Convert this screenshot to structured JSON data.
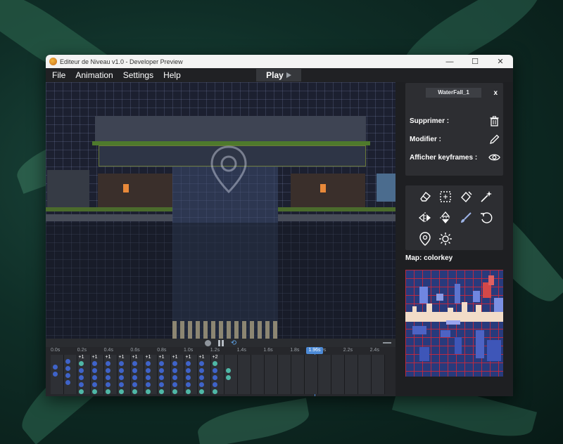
{
  "window": {
    "title": "Editeur de Niveau v1.0 - Developer Preview",
    "controls": {
      "minimize": "—",
      "maximize": "☐",
      "close": "✕"
    }
  },
  "menu": {
    "items": [
      "File",
      "Animation",
      "Settings",
      "Help"
    ],
    "play_label": "Play"
  },
  "inspector": {
    "object_name": "WaterFall_1",
    "close_label": "x",
    "rows": [
      {
        "label": "Supprimer :",
        "icon": "trash-icon"
      },
      {
        "label": "Modifier :",
        "icon": "pencil-icon"
      },
      {
        "label": "Afficher keyframes :",
        "icon": "eye-icon"
      }
    ]
  },
  "tools": [
    "eraser-icon",
    "select-rect-icon",
    "bucket-erase-icon",
    "magic-wand-icon",
    "flip-horizontal-icon",
    "flip-vertical-icon",
    "brush-icon",
    "undo-icon",
    "map-pin-icon",
    "sun-icon"
  ],
  "map": {
    "title": "Map: colorkey"
  },
  "timeline": {
    "ticks": [
      "0.0s",
      "0.2s",
      "0.4s",
      "0.6s",
      "0.8s",
      "1.0s",
      "1.2s",
      "1.4s",
      "1.6s",
      "1.8s",
      "2.0s",
      "2.2s",
      "2.4s"
    ],
    "current_time": "1.96s",
    "increments": [
      "+1",
      "+1",
      "+1",
      "+1",
      "+1",
      "+1",
      "+1",
      "+1",
      "+1",
      "+1",
      "+2"
    ],
    "keyframe_colors": {
      "blue": "#3f63c9",
      "teal": "#4fb7a6"
    }
  },
  "colors": {
    "accent": "#4c8ad6",
    "panel": "#2d2e32",
    "grid_red": "#c8283c"
  }
}
